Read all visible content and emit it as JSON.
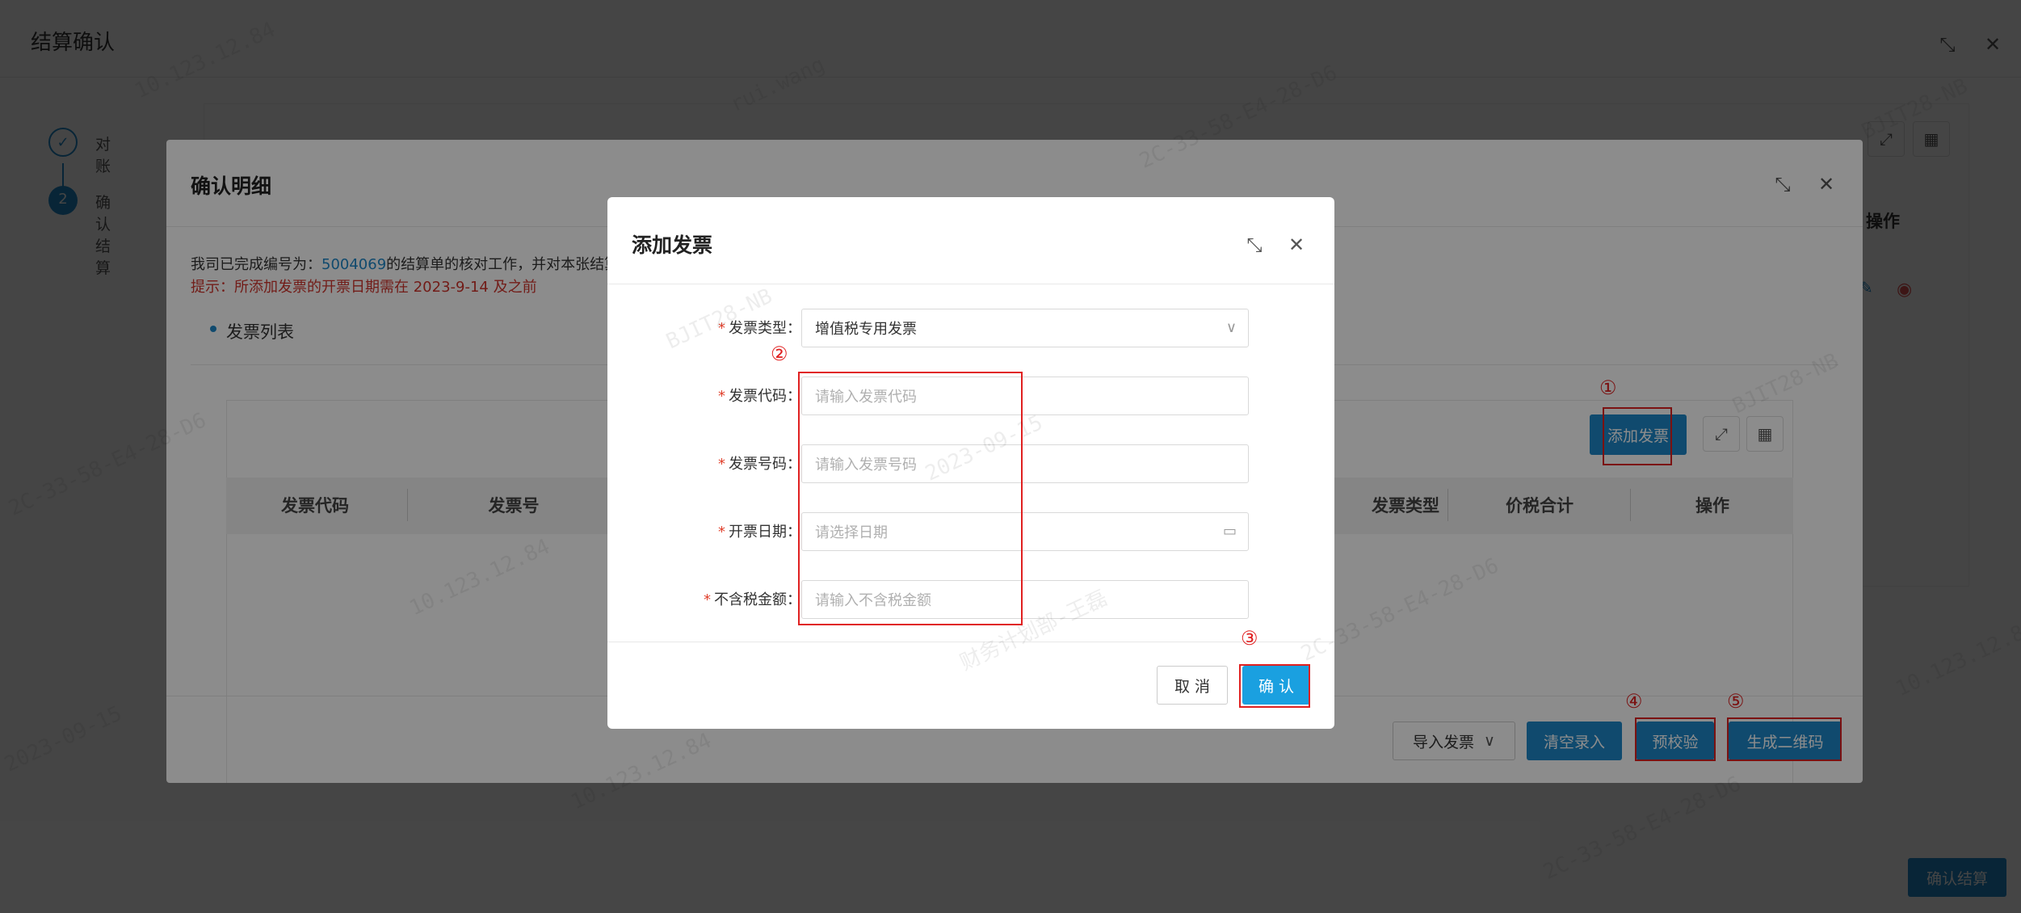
{
  "page": {
    "title": "结算确认",
    "steps": [
      {
        "num": "✓",
        "label": "对账"
      },
      {
        "num": "2",
        "label": "确认结算"
      }
    ],
    "bg_column_op": "操作",
    "confirm_settle": "确认结算"
  },
  "detail_modal": {
    "title": "确认明细",
    "text_prefix": "我司已完成编号为：",
    "settlement_no": "5004069",
    "text_suffix": "的结算单的核对工作，并对本张结算",
    "tip": "提示：所添加发票的开票日期需在 2023-9-14 及之前",
    "section": "发票列表",
    "add_invoice": "添加发票",
    "columns": [
      "发票代码",
      "发票号",
      "发票类型",
      "价税合计",
      "操作"
    ],
    "footer": {
      "import": "导入发票",
      "clear": "清空录入",
      "precheck": "预校验",
      "qrcode": "生成二维码"
    }
  },
  "add_invoice_modal": {
    "title": "添加发票",
    "fields": [
      {
        "label": "发票类型",
        "value": "增值税专用发票",
        "placeholder": ""
      },
      {
        "label": "发票代码",
        "value": "",
        "placeholder": "请输入发票代码"
      },
      {
        "label": "发票号码",
        "value": "",
        "placeholder": "请输入发票号码"
      },
      {
        "label": "开票日期",
        "value": "",
        "placeholder": "请选择日期"
      },
      {
        "label": "不含税金额",
        "value": "",
        "placeholder": "请输入不含税金额"
      }
    ],
    "cancel": "取 消",
    "confirm": "确 认"
  },
  "annotations": [
    "①",
    "②",
    "③",
    "④",
    "⑤"
  ],
  "watermark": {
    "lines": [
      "10.123.12.84",
      "BJIT28-NB",
      "rui.wang",
      "2023-09-15",
      "2C-33-58-E4-28-D6",
      "财务计划部-王磊"
    ]
  },
  "colors": {
    "primary": "#1e88c8",
    "danger": "#e02020",
    "tip": "#d0342c"
  }
}
